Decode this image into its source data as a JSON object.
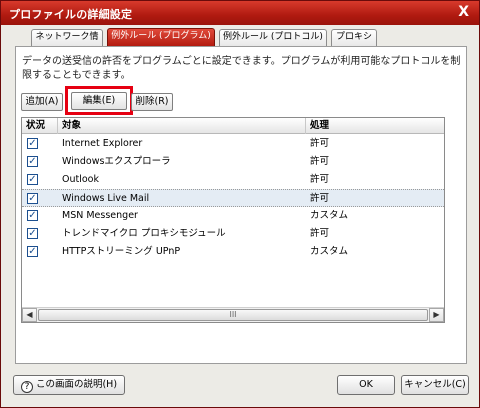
{
  "window": {
    "title": "プロファイルの詳細設定",
    "close_glyph": "X"
  },
  "tabs": [
    {
      "label": "ネットワーク情報",
      "active": false
    },
    {
      "label": "例外ルール (プログラム)",
      "active": true
    },
    {
      "label": "例外ルール (プロトコル)",
      "active": false
    },
    {
      "label": "プロキシ",
      "active": false
    }
  ],
  "description": "データの送受信の許否をプログラムごとに設定できます。プログラムが利用可能なプロトコルを制限することもできます。",
  "toolbar": {
    "add_label": "追加(A)",
    "edit_label": "編集(E)",
    "delete_label": "削除(R)"
  },
  "list": {
    "columns": [
      "状況",
      "対象",
      "処理"
    ],
    "rows": [
      {
        "checked": true,
        "target": "Internet Explorer",
        "action": "許可",
        "selected": false
      },
      {
        "checked": true,
        "target": "Windowsエクスプローラ",
        "action": "許可",
        "selected": false
      },
      {
        "checked": true,
        "target": "Outlook",
        "action": "許可",
        "selected": false
      },
      {
        "checked": true,
        "target": "Windows Live Mail",
        "action": "許可",
        "selected": true
      },
      {
        "checked": true,
        "target": "MSN Messenger",
        "action": "カスタム",
        "selected": false
      },
      {
        "checked": true,
        "target": "トレンドマイクロ プロキシモジュール",
        "action": "許可",
        "selected": false
      },
      {
        "checked": true,
        "target": "HTTPストリーミング UPnP",
        "action": "カスタム",
        "selected": false
      }
    ],
    "scroll_left": "◀",
    "scroll_right": "▶",
    "scroll_thumb": "III",
    "check_glyph": "✓"
  },
  "footer": {
    "help_icon_glyph": "?",
    "help_label": "この画面の説明(H)",
    "ok_label": "OK",
    "cancel_label": "キャンセル(C)"
  },
  "colors": {
    "title_bar": "#c0281c",
    "highlight": "#e60012",
    "selected_row": "#e4ecf4"
  }
}
